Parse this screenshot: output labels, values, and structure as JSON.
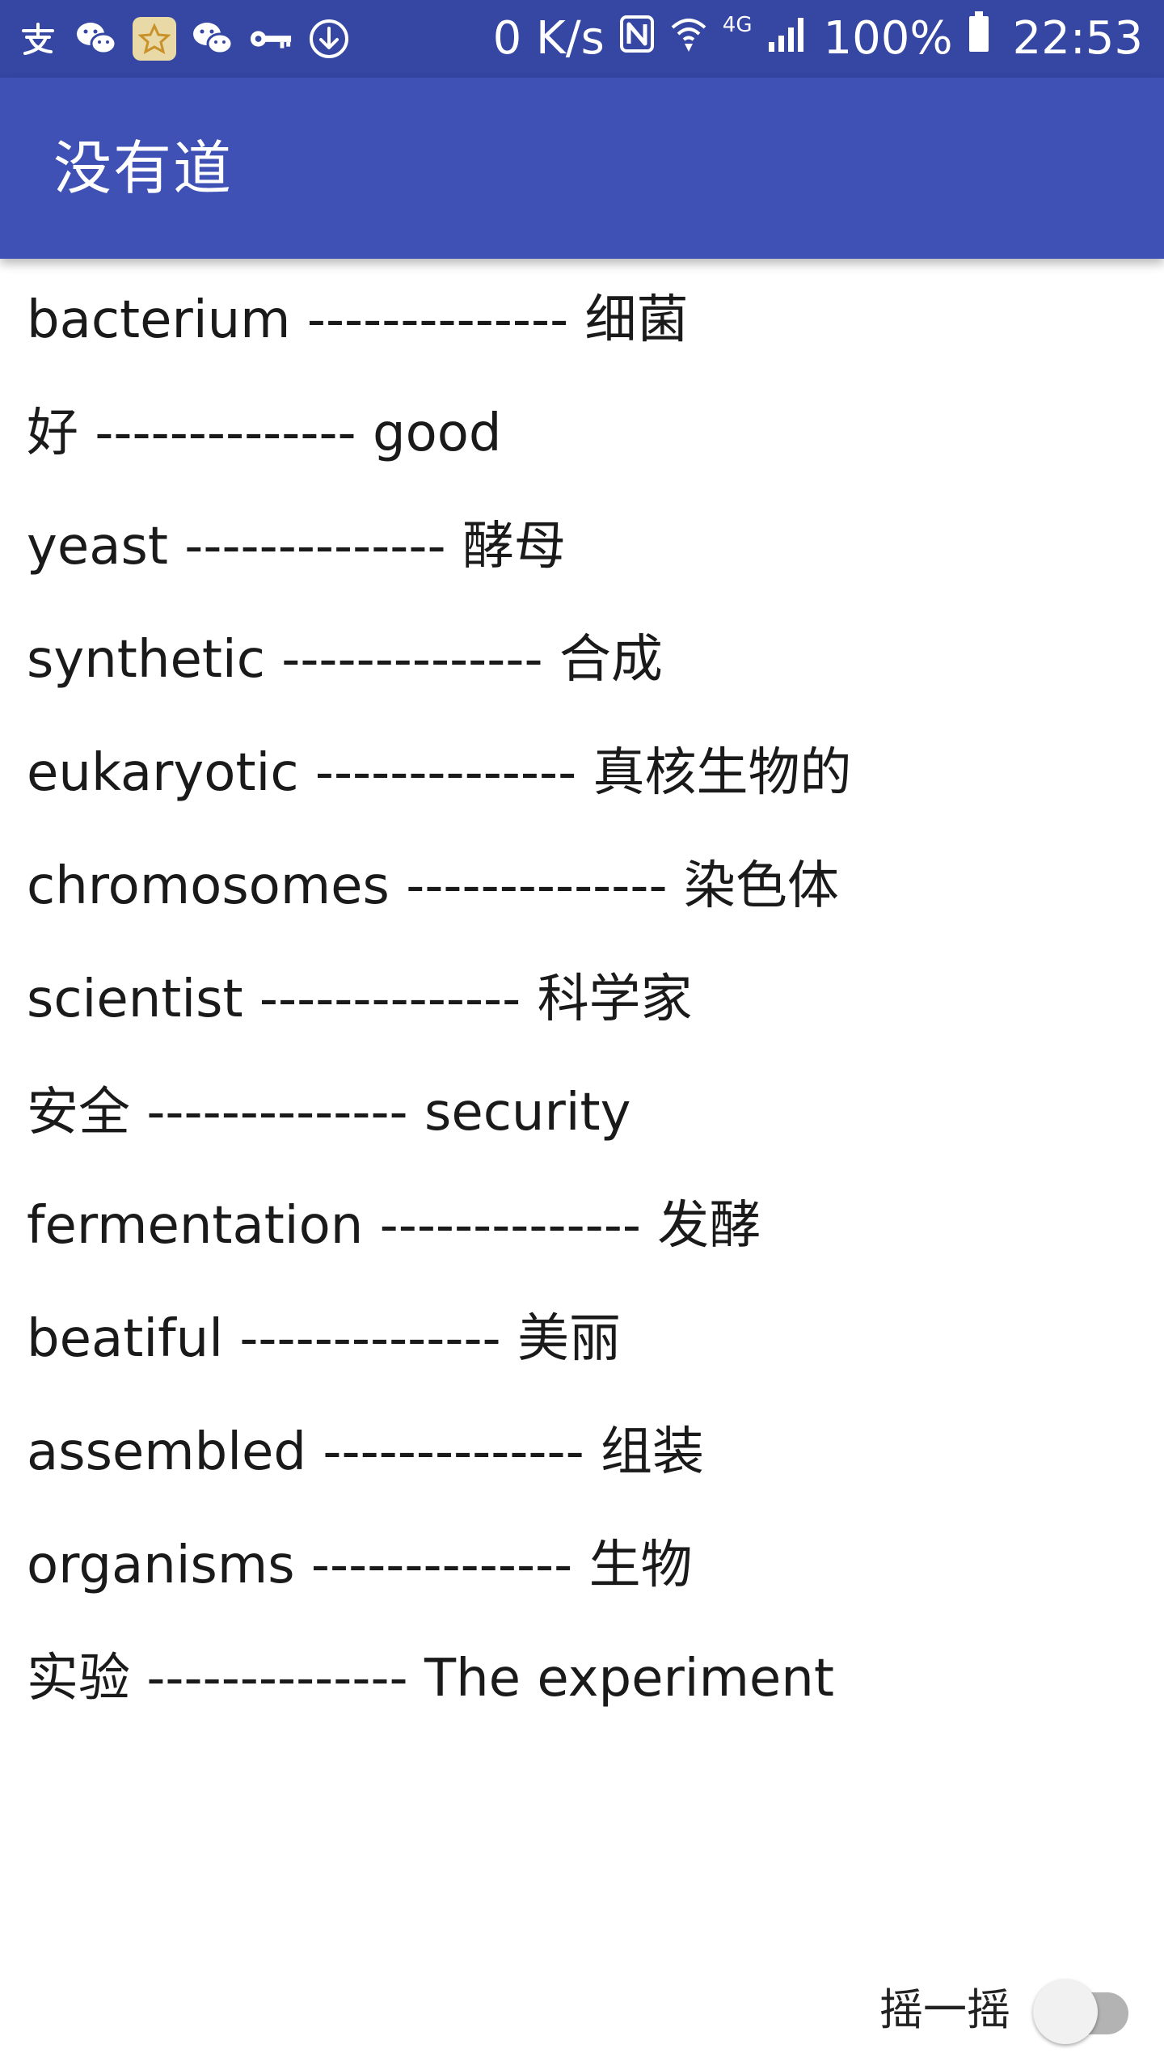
{
  "status_bar": {
    "network_speed": "0 K/s",
    "network_type": "4G",
    "battery": "100%",
    "time": "22:53",
    "left_icons": [
      "alipay-icon",
      "wechat-icon",
      "star-badge-icon",
      "wechat-icon",
      "key-icon",
      "download-icon"
    ],
    "right_icons": [
      "nfc-icon",
      "wifi-icon",
      "signal-icon",
      "battery-icon"
    ]
  },
  "app_bar": {
    "title": "没有道"
  },
  "words": [
    "bacterium -------------- 细菌",
    "好 -------------- good",
    "yeast -------------- 酵母",
    "synthetic -------------- 合成",
    "eukaryotic -------------- 真核生物的",
    "chromosomes -------------- 染色体",
    "scientist -------------- 科学家",
    "安全 -------------- security",
    "fermentation -------------- 发酵",
    "beatiful -------------- 美丽",
    "assembled -------------- 组装",
    "organisms -------------- 生物",
    "实验 -------------- The experiment"
  ],
  "shake": {
    "label": "摇一摇",
    "enabled": false
  },
  "colors": {
    "status_bar": "#3546a3",
    "app_bar": "#3f51b5",
    "background": "#ffffff"
  }
}
